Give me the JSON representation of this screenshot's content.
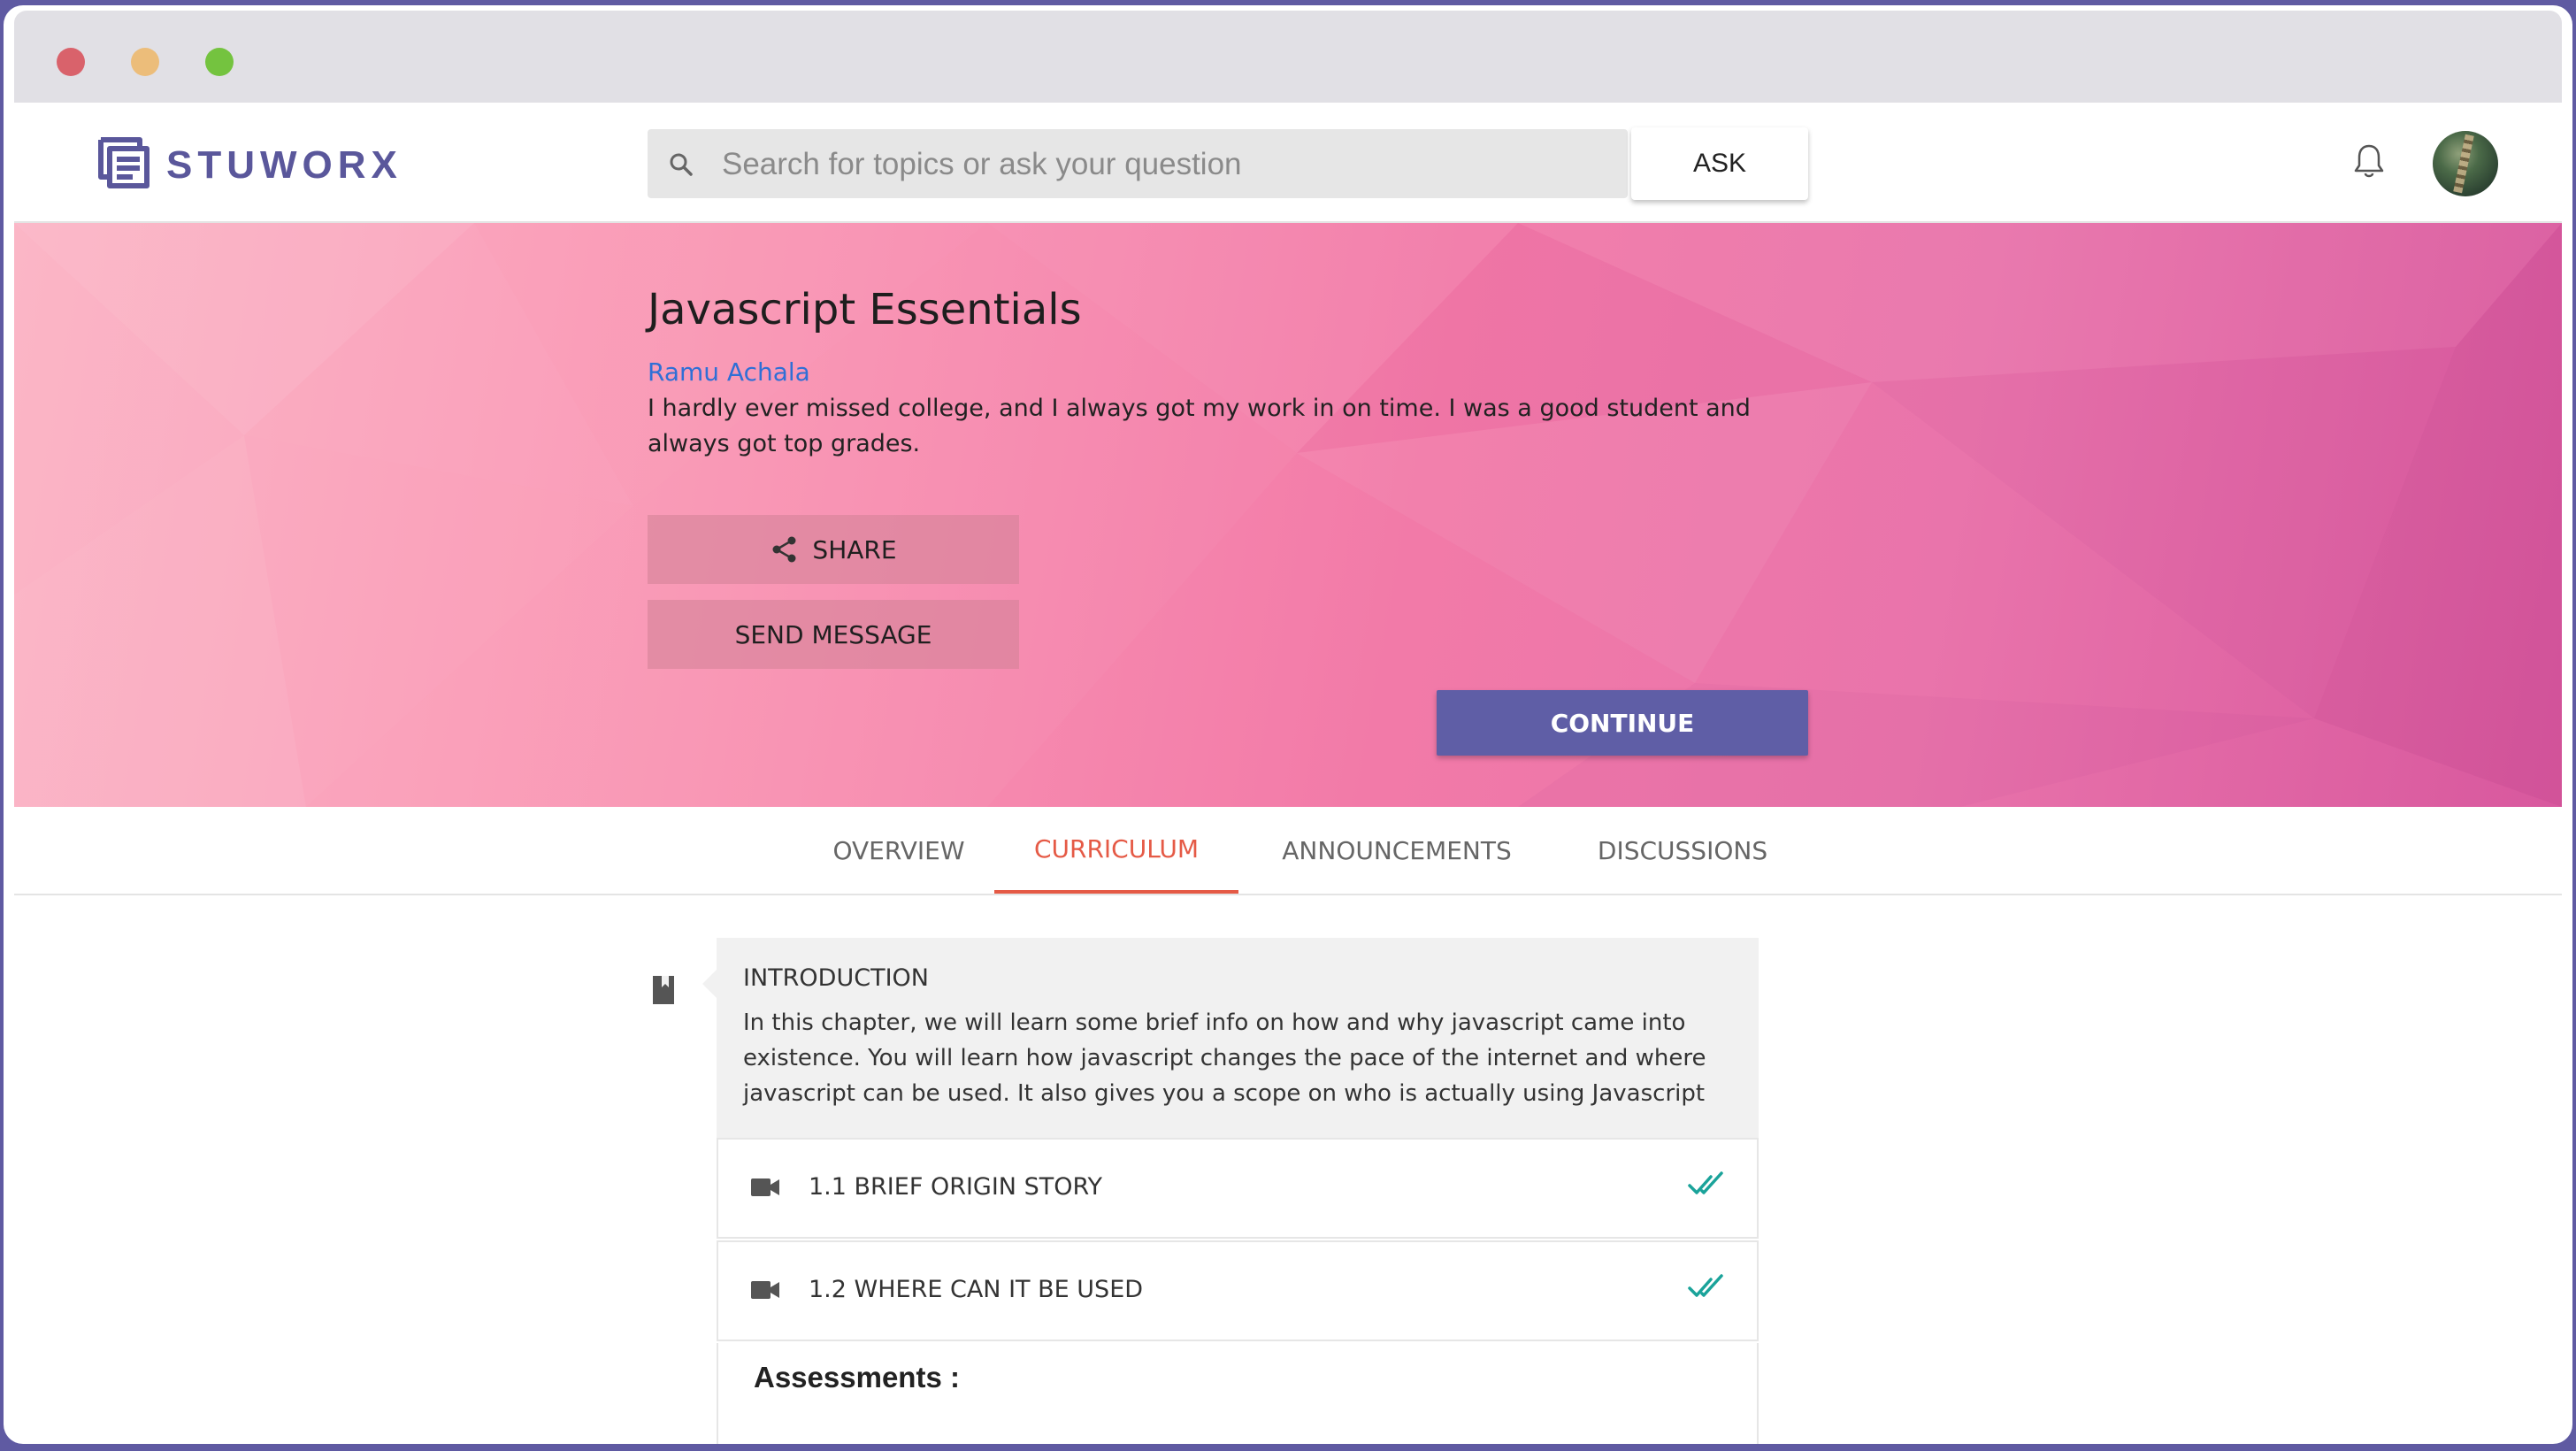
{
  "window": {
    "controls": [
      "close",
      "minimize",
      "maximize"
    ]
  },
  "header": {
    "logo_text": "STUWORX",
    "search": {
      "placeholder": "Search for topics or ask your question",
      "value": ""
    },
    "ask_label": "ASK",
    "icons": [
      "search-icon",
      "bell-icon",
      "avatar"
    ]
  },
  "course": {
    "title": "Javascript Essentials",
    "author": "Ramu Achala",
    "description": "I hardly ever missed college, and I always got my work in on time. I was a good student and always got top grades.",
    "share_label": "SHARE",
    "message_label": "SEND MESSAGE",
    "continue_label": "CONTINUE"
  },
  "tabs": [
    {
      "label": "OVERVIEW",
      "active": false
    },
    {
      "label": "CURRICULUM",
      "active": true
    },
    {
      "label": "ANNOUNCEMENTS",
      "active": false
    },
    {
      "label": "DISCUSSIONS",
      "active": false
    }
  ],
  "curriculum": {
    "chapter": {
      "title": "INTRODUCTION",
      "description": "In this chapter, we will learn some brief info on how and why javascript came into existence. You will learn how javascript changes the pace of the internet and where javascript can be used. It also gives you a scope on who is actually using Javascript"
    },
    "lessons": [
      {
        "label": "1.1 BRIEF ORIGIN STORY",
        "icon": "video-icon",
        "status": "completed"
      },
      {
        "label": "1.2 WHERE CAN IT BE USED",
        "icon": "video-icon",
        "status": "completed"
      }
    ],
    "assessments_label": "Assessments :"
  },
  "colors": {
    "brand": "#5a579b",
    "accent": "#e55a46",
    "continue": "#5f5ea6",
    "link": "#2f6fd6",
    "check": "#1aa39a"
  }
}
